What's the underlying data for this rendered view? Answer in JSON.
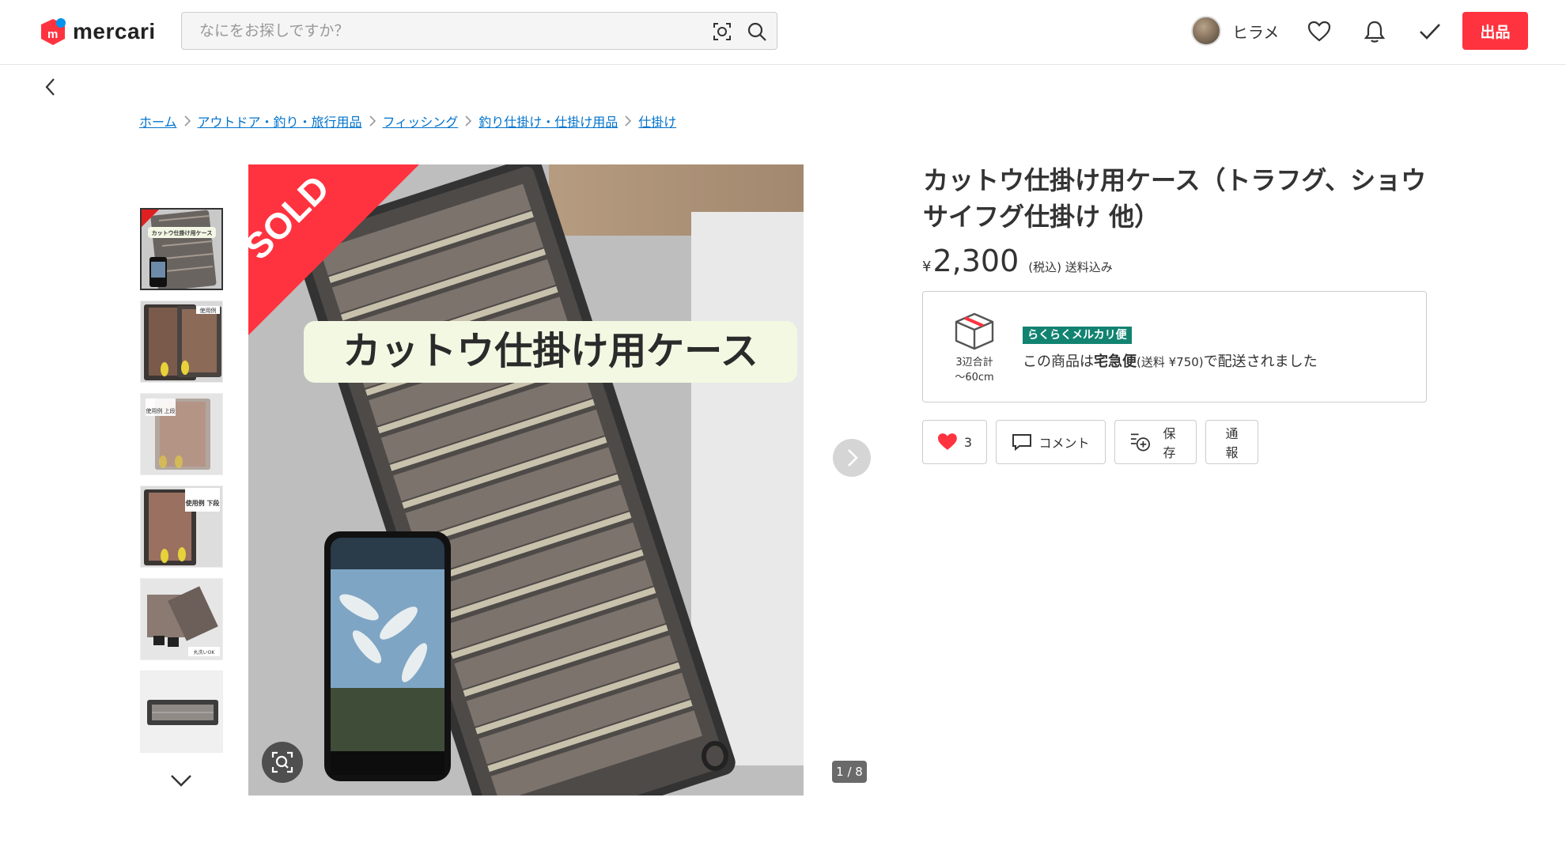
{
  "header": {
    "logo_text": "mercari",
    "search_placeholder": "なにをお探しですか？",
    "user_name": "ヒラメ",
    "sell_label": "出品"
  },
  "breadcrumb": [
    "ホーム",
    "アウトドア・釣り・旅行用品",
    "フィッシング",
    "釣り仕掛け・仕掛け用品",
    "仕掛け"
  ],
  "gallery": {
    "sold_label": "SOLD",
    "banner_text": "カットウ仕掛け用ケース",
    "counter": "1 / 8",
    "thumbnails": [
      {
        "label": "カットウ仕掛け用ケース"
      },
      {
        "label": "使用例"
      },
      {
        "label": "使用例 上段"
      },
      {
        "label": "使用例 下段"
      },
      {
        "label": "丸洗いOK"
      },
      {
        "label": ""
      }
    ]
  },
  "item": {
    "title": "カットウ仕掛け用ケース（トラフグ、ショウサイフグ仕掛け 他）",
    "price_symbol": "¥",
    "price": "2,300",
    "tax_note": "(税込) 送料込み"
  },
  "shipping": {
    "size_line1": "3辺合計",
    "size_line2": "〜60cm",
    "method_badge": "らくらくメルカリ便",
    "text_prefix": "この商品は",
    "text_method": "宅急便",
    "text_fee": "(送料 ¥750)",
    "text_suffix": "で配送されました"
  },
  "actions": {
    "like_count": "3",
    "comment_label": "コメント",
    "save_label": "保存",
    "report_label": "通報"
  },
  "colors": {
    "brand_red": "#ff333f",
    "link_blue": "#0073cc",
    "rakuraku_green": "#128371"
  }
}
